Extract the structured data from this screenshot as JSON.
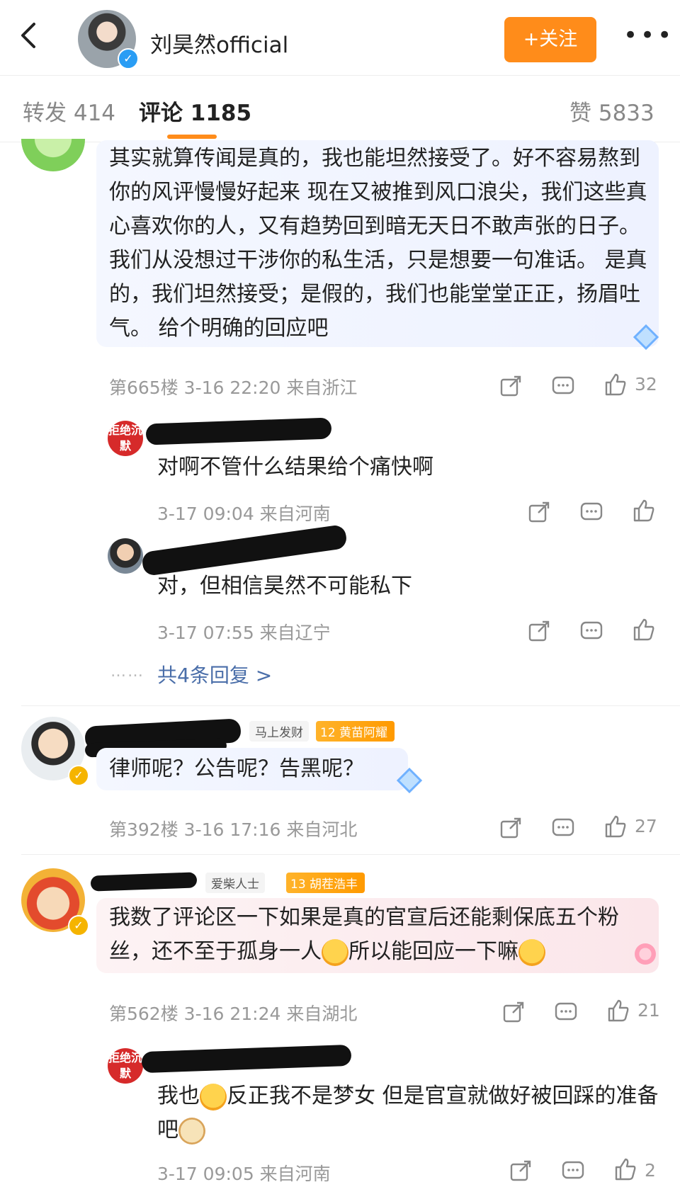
{
  "header": {
    "title": "刘昊然official",
    "follow_label": "+关注",
    "more_icon": "more-icon"
  },
  "tabs": [
    {
      "label": "转发 414"
    },
    {
      "label": "评论 1185"
    },
    {
      "label": "赞 5833"
    }
  ],
  "comments": [
    {
      "text": "其实就算传闻是真的，我也能坦然接受了。好不容易熬到你的风评慢慢好起来 现在又被推到风口浪尖，我们这些真心喜欢你的人，又有趋势回到暗无天日不敢声张的日子。 我们从没想过干涉你的私生活，只是想要一句准话。 是真的，我们坦然接受；是假的，我们也能堂堂正正，扬眉吐气。 给个明确的回应吧",
      "meta": "第665楼 3-16 22:20 来自浙江",
      "likes": "32",
      "replies": [
        {
          "badge": "拒绝沉默",
          "text": "对啊不管什么结果给个痛快啊",
          "meta": "3-17 09:04 来自河南"
        },
        {
          "text": "对，但相信昊然不可能私下",
          "meta": "3-17 07:55 来自辽宁"
        }
      ],
      "more_replies": "共4条回复 >"
    },
    {
      "tag": "马上发财",
      "fan_level": "12",
      "fan_label": "黄苗阿耀",
      "text": "律师呢？公告呢？告黑呢？",
      "meta": "第392楼 3-16 17:16 来自河北",
      "likes": "27"
    },
    {
      "tag": "爱柴人士",
      "fan_level": "13",
      "fan_label": "胡茬浩丰",
      "text_a": "我数了评论区一下如果是真的官宣后还能剩保底五个粉丝，还不至于孤身一人",
      "text_b": "所以能回应一下嘛",
      "meta": "第562楼 3-16 21:24 来自湖北",
      "likes": "21",
      "replies": [
        {
          "badge": "拒绝沉默",
          "text_a": "我也",
          "text_b": "反正我不是梦女 但是官宣就做好被回踩的准备吧",
          "meta": "3-17 09:05 来自河南",
          "likes": "2"
        }
      ]
    }
  ],
  "colors": {
    "accent": "#ff8c1a",
    "link": "#4a6ea9",
    "verified": "#2a9df4"
  }
}
